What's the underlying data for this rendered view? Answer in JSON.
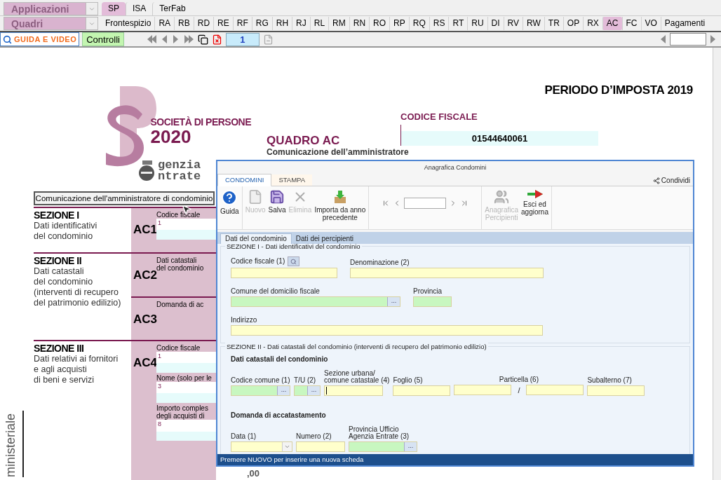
{
  "top_bar": {
    "app_menu": "Applicazioni",
    "quadri_menu": "Quadri",
    "app_tabs": [
      {
        "label": "SP",
        "selected": true
      },
      {
        "label": "ISA",
        "selected": false
      },
      {
        "label": "TerFab",
        "selected": false
      }
    ],
    "quadri_tabs": [
      {
        "label": "Frontespizio",
        "selected": false
      },
      {
        "label": "RA",
        "selected": false
      },
      {
        "label": "RB",
        "selected": false
      },
      {
        "label": "RD",
        "selected": false
      },
      {
        "label": "RE",
        "selected": false
      },
      {
        "label": "RF",
        "selected": false
      },
      {
        "label": "RG",
        "selected": false
      },
      {
        "label": "RH",
        "selected": false
      },
      {
        "label": "RJ",
        "selected": false
      },
      {
        "label": "RL",
        "selected": false
      },
      {
        "label": "RM",
        "selected": false
      },
      {
        "label": "RN",
        "selected": false
      },
      {
        "label": "RO",
        "selected": false
      },
      {
        "label": "RP",
        "selected": false
      },
      {
        "label": "RQ",
        "selected": false
      },
      {
        "label": "RS",
        "selected": false
      },
      {
        "label": "RT",
        "selected": false
      },
      {
        "label": "RU",
        "selected": false
      },
      {
        "label": "DI",
        "selected": false
      },
      {
        "label": "RV",
        "selected": false
      },
      {
        "label": "RW",
        "selected": false
      },
      {
        "label": "TR",
        "selected": false
      },
      {
        "label": "OP",
        "selected": false
      },
      {
        "label": "RX",
        "selected": false
      },
      {
        "label": "AC",
        "selected": true
      },
      {
        "label": "FC",
        "selected": false
      },
      {
        "label": "VO",
        "selected": false
      },
      {
        "label": "Pagamenti",
        "selected": false
      }
    ]
  },
  "toolbar": {
    "guide_button": "GUIDA E VIDEO",
    "checks_button": "Controlli",
    "page_number": "1"
  },
  "form": {
    "period": "PERIODO D’IMPOSTA 2019",
    "codice_fiscale_label": "CODICE FISCALE",
    "codice_fiscale": "01544640061",
    "logo_lines": [
      "SOCIETÀ DI PERSONE",
      "2020"
    ],
    "agency_lines": [
      "genzia",
      "ntrate"
    ],
    "quadro_title": "QUADRO AC",
    "quadro_subtitle": "Comunicazione dell’amministratore",
    "open_button": "Comunicazione dell'amministratore di condominio",
    "sections": [
      {
        "title": "SEZIONE I",
        "lines": [
          "Dati identificativi",
          "del condominio"
        ],
        "rows": [
          {
            "code": "AC1",
            "items": [
              {
                "label": "Codice fiscale",
                "value": "1"
              }
            ]
          }
        ]
      },
      {
        "title": "SEZIONE II",
        "lines": [
          "Dati catastali",
          "del condominio",
          "(interventi di recupero",
          "del patrimonio edilizio)"
        ],
        "rows": [
          {
            "code": "AC2",
            "items": [
              {
                "label": "Dati catastali del condominio"
              }
            ]
          },
          {
            "code": "AC3",
            "items": [
              {
                "label": "Domanda di ac"
              }
            ]
          }
        ]
      },
      {
        "title": "SEZIONE III",
        "lines": [
          "Dati relativi ai fornitori",
          "e agli acquisti",
          "di beni e servizi"
        ],
        "rows": [
          {
            "code": "AC4",
            "items": [
              {
                "label": "Codice fiscale",
                "value": "1"
              },
              {
                "label": "Nome (solo per le",
                "value": "3"
              },
              {
                "label": "Importo comples\ndegli acquisti di",
                "value": "8",
                "suffix": ",00"
              }
            ]
          }
        ]
      }
    ],
    "side_label": "ministeriale"
  },
  "dialog": {
    "title": "Anagrafica Condomini",
    "share": "Condividi",
    "tabs": [
      {
        "label": "CONDOMINI",
        "selected": true
      },
      {
        "label": "STAMPA",
        "selected": false
      }
    ],
    "tool_groups": [
      [
        {
          "kind": "help",
          "label": "Guida",
          "disabled": false
        }
      ],
      [
        {
          "kind": "new",
          "label": "Nuovo",
          "disabled": true
        },
        {
          "kind": "save",
          "label": "Salva",
          "disabled": false
        },
        {
          "kind": "delete",
          "label": "Elimina",
          "disabled": true
        },
        {
          "kind": "import",
          "label": "Importa da anno\nprecedente",
          "disabled": false
        }
      ],
      [
        {
          "kind": "nav"
        }
      ],
      [
        {
          "kind": "people",
          "label": "Anagrafica\nPercipienti",
          "disabled": true
        },
        {
          "kind": "exit",
          "label": "Esci ed\naggiorna",
          "disabled": false
        }
      ]
    ],
    "inner_tabs": [
      {
        "label": "Dati del condominio",
        "selected": true
      },
      {
        "label": "Dati dei percipienti",
        "selected": false
      }
    ],
    "section_1": {
      "title": "SEZIONE I - Dati identificativi del condominio",
      "rows": [
        [
          {
            "label": "Codice fiscale (1)",
            "kind": "search",
            "color": "#ffffcc"
          },
          {
            "label": "Denominazione (2)",
            "kind": "text",
            "color": "#ffffcc"
          }
        ],
        [
          {
            "label": "Comune del domicilio fiscale",
            "kind": "lookup",
            "button": "...",
            "color": "#c8f7c0"
          },
          {
            "label": "Provincia",
            "kind": "text",
            "color": "#c8f7c0"
          }
        ],
        [
          {
            "label": "Indirizzo",
            "kind": "text",
            "color": "#ffffcc"
          }
        ]
      ]
    },
    "section_2": {
      "title": "SEZIONE II - Dati catastali del condominio (interventi di recupero del patrimonio edilizio)",
      "groups": [
        {
          "heading": "Dati catastali del condominio",
          "fields": [
            {
              "label": "Codice comune (1)",
              "kind": "lookup",
              "button": "...",
              "color": "#c8f7c0"
            },
            {
              "label": "T/U (2)",
              "kind": "lookup",
              "button": "...",
              "color": "#c8f7c0"
            },
            {
              "label": "Sezione urbana/\ncomune catastale (4)",
              "kind": "text",
              "color": "#ffffcc",
              "focused": true
            },
            {
              "label": "Foglio (5)",
              "kind": "text",
              "color": "#ffffcc"
            },
            {
              "label": "Particella (6)",
              "kind": "split",
              "separator": "/",
              "color": "#ffffcc"
            },
            {
              "label": "Subalterno (7)",
              "kind": "text",
              "color": "#ffffcc"
            }
          ]
        },
        {
          "heading": "Domanda di accatastamento",
          "fields": [
            {
              "label": "Data (1)",
              "kind": "date",
              "color": "#ffffcc"
            },
            {
              "label": "Numero (2)",
              "kind": "text",
              "color": "#ffffcc"
            },
            {
              "label": "Provincia Ufficio\nAgenzia Entrate (3)",
              "kind": "lookup",
              "button": "...",
              "color": "#c8f7c0"
            }
          ]
        }
      ]
    },
    "status": "Premere NUOVO per inserire una nuova scheda"
  }
}
